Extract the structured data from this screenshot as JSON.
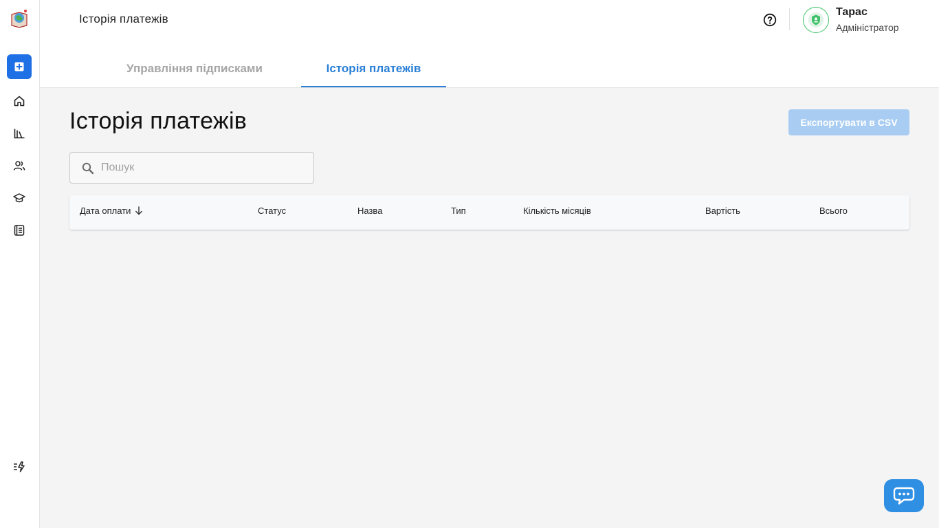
{
  "header": {
    "title": "Історія платежів",
    "user": {
      "name": "Тарас",
      "role": "Адміністратор"
    }
  },
  "tabs": [
    {
      "label": "Управління підписками",
      "active": false
    },
    {
      "label": "Історія платежів",
      "active": true
    }
  ],
  "main": {
    "title": "Історія платежів",
    "export_label": "Експортувати в CSV",
    "search": {
      "placeholder": "Пошук",
      "value": ""
    },
    "table": {
      "columns": [
        "Дата оплати",
        "Статус",
        "Назва",
        "Тип",
        "Кількість місяців",
        "Вартість",
        "Всього"
      ],
      "sorted_column": "Дата оплати",
      "sort_direction": "desc",
      "rows": []
    }
  },
  "sidebar": {
    "items": [
      {
        "icon": "plus-square-icon"
      },
      {
        "icon": "home-icon"
      },
      {
        "icon": "library-icon"
      },
      {
        "icon": "users-icon"
      },
      {
        "icon": "graduation-cap-icon"
      },
      {
        "icon": "notebook-icon"
      }
    ],
    "bottom_icon": "quick-actions-icon"
  },
  "colors": {
    "accent": "#2a7fd6",
    "primary_button": "#1f6fe5",
    "export_disabled": "#a9cdf2",
    "avatar_ring": "#3fc26a",
    "chat_button": "#2f8fe3"
  }
}
